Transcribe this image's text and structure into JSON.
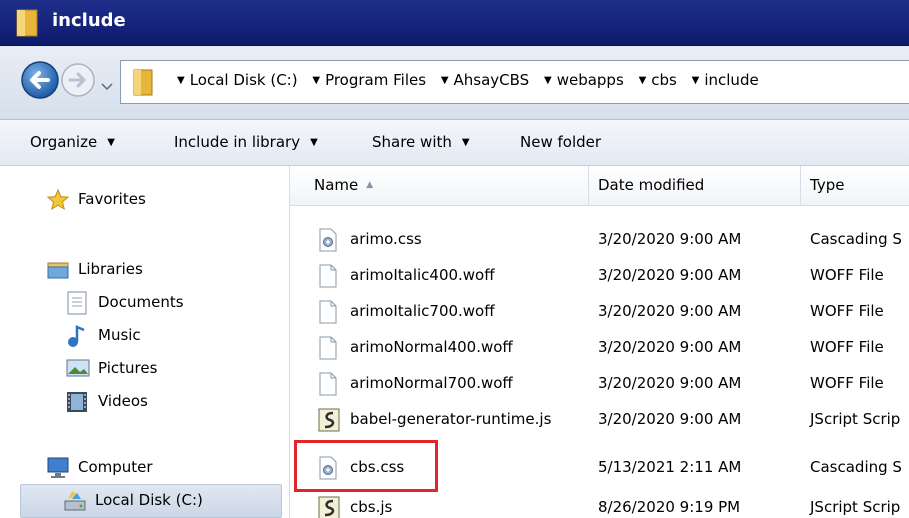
{
  "window": {
    "title": "include",
    "title_bar_color": "#15227a",
    "folder_icon": "folder-icon"
  },
  "address": {
    "crumbs": [
      "Local Disk (C:)",
      "Program Files",
      "AhsayCBS",
      "webapps",
      "cbs",
      "include"
    ],
    "back_icon": "back-arrow-icon",
    "forward_icon": "forward-arrow-icon",
    "history_icon": "chevron-down-icon"
  },
  "toolbar": {
    "organize": "Organize",
    "include_library": "Include in library",
    "share_with": "Share with",
    "new_folder": "New folder"
  },
  "nav": {
    "favorites": "Favorites",
    "libraries": "Libraries",
    "documents": "Documents",
    "music": "Music",
    "pictures": "Pictures",
    "videos": "Videos",
    "computer": "Computer",
    "local_disk": "Local Disk (C:)"
  },
  "columns": {
    "name": "Name",
    "date": "Date modified",
    "type": "Type"
  },
  "files": [
    {
      "name": "arimo.css",
      "date": "3/20/2020 9:00 AM",
      "type": "Cascading S",
      "icon": "css-file-icon"
    },
    {
      "name": "arimoItalic400.woff",
      "date": "3/20/2020 9:00 AM",
      "type": "WOFF File",
      "icon": "blank-file-icon"
    },
    {
      "name": "arimoItalic700.woff",
      "date": "3/20/2020 9:00 AM",
      "type": "WOFF File",
      "icon": "blank-file-icon"
    },
    {
      "name": "arimoNormal400.woff",
      "date": "3/20/2020 9:00 AM",
      "type": "WOFF File",
      "icon": "blank-file-icon"
    },
    {
      "name": "arimoNormal700.woff",
      "date": "3/20/2020 9:00 AM",
      "type": "WOFF File",
      "icon": "blank-file-icon"
    },
    {
      "name": "babel-generator-runtime.js",
      "date": "3/20/2020 9:00 AM",
      "type": "JScript Scrip",
      "icon": "js-file-icon"
    },
    {
      "name": "cbs.css",
      "date": "5/13/2021 2:11 AM",
      "type": "Cascading S",
      "icon": "css-file-icon"
    },
    {
      "name": "cbs.js",
      "date": "8/26/2020 9:19 PM",
      "type": "JScript Scrip",
      "icon": "js-file-icon"
    }
  ],
  "annotation_color": "#e0262c"
}
